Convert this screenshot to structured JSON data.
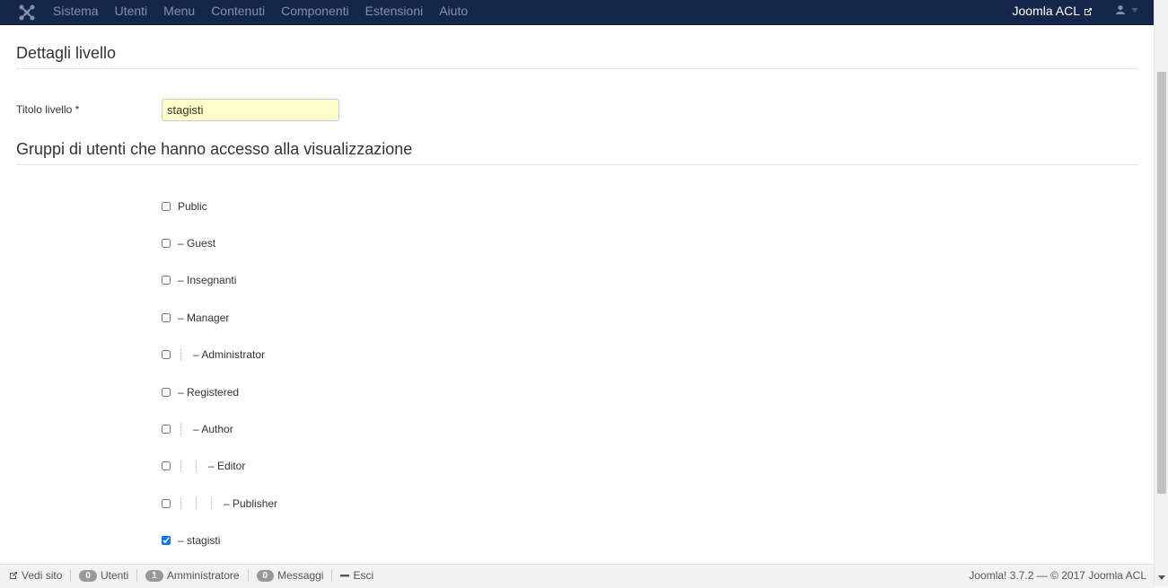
{
  "navbar": {
    "menu": [
      "Sistema",
      "Utenti",
      "Menu",
      "Contenuti",
      "Componenti",
      "Estensioni",
      "Aiuto"
    ],
    "site_title": "Joomla ACL"
  },
  "form": {
    "section1_title": "Dettagli livello",
    "title_label": "Titolo livello *",
    "title_value": "stagisti",
    "section2_title": "Gruppi di utenti che hanno accesso alla visualizzazione"
  },
  "groups": [
    {
      "label": "Public",
      "depth": 0,
      "checked": false
    },
    {
      "label": "– Guest",
      "depth": 0,
      "checked": false
    },
    {
      "label": "– Insegnanti",
      "depth": 0,
      "checked": false
    },
    {
      "label": "– Manager",
      "depth": 0,
      "checked": false
    },
    {
      "label": "– Administrator",
      "depth": 1,
      "checked": false
    },
    {
      "label": "– Registered",
      "depth": 0,
      "checked": false
    },
    {
      "label": "– Author",
      "depth": 1,
      "checked": false
    },
    {
      "label": "– Editor",
      "depth": 2,
      "checked": false
    },
    {
      "label": "– Publisher",
      "depth": 3,
      "checked": false
    },
    {
      "label": "– stagisti",
      "depth": 0,
      "checked": true
    }
  ],
  "status": {
    "view_site": "Vedi sito",
    "users_count": "0",
    "users_label": "Utenti",
    "admin_count": "1",
    "admin_label": "Amministratore",
    "messages_count": "0",
    "messages_label": "Messaggi",
    "logout": "Esci",
    "version": "Joomla! 3.7.2 — © 2017 Joomla ACL"
  }
}
